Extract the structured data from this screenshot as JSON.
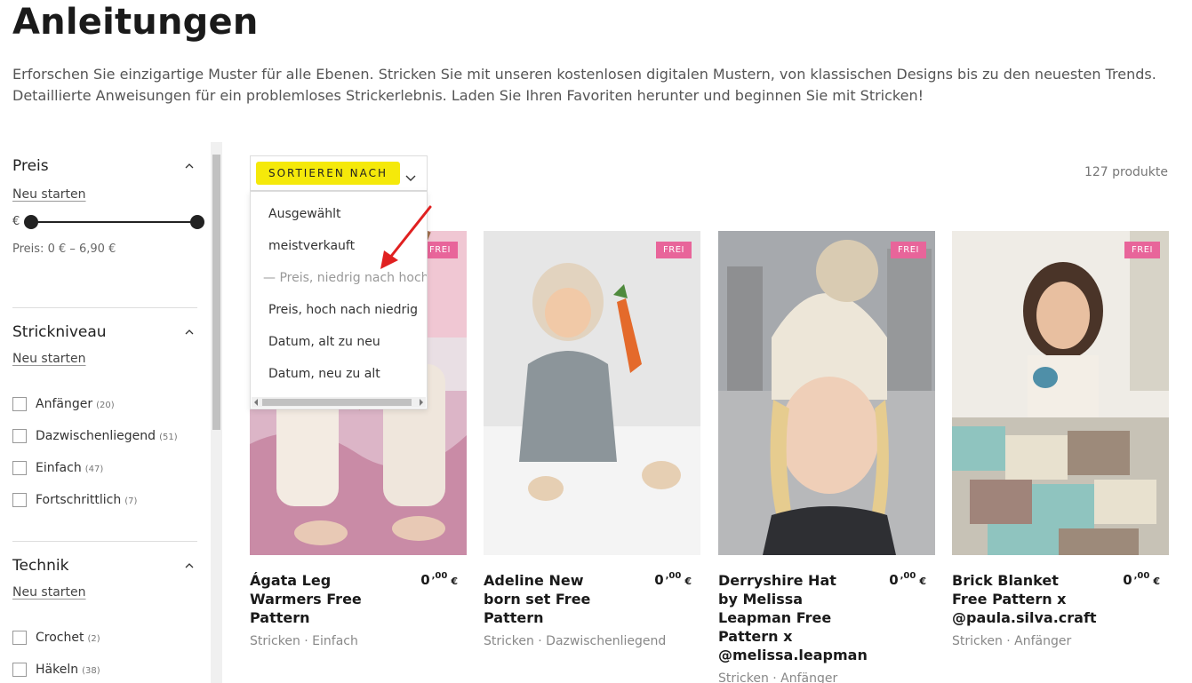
{
  "page": {
    "title": "Anleitungen",
    "intro": "Erforschen Sie einzigartige Muster für alle Ebenen. Stricken Sie mit unseren kostenlosen digitalen Mustern, von klassischen Designs bis zu den neuesten Trends. Detaillierte Anweisungen für ein problemloses Strickerlebnis. Laden Sie Ihren Favoriten herunter und beginnen Sie mit Stricken!"
  },
  "filters": {
    "price": {
      "title": "Preis",
      "reset": "Neu starten",
      "currency_label": "€",
      "range_text": "Preis: 0 € – 6,90 €"
    },
    "level": {
      "title": "Strickniveau",
      "reset": "Neu starten",
      "options": [
        {
          "label": "Anfänger",
          "count": "(20)"
        },
        {
          "label": "Dazwischenliegend",
          "count": "(51)"
        },
        {
          "label": "Einfach",
          "count": "(47)"
        },
        {
          "label": "Fortschrittlich",
          "count": "(7)"
        }
      ]
    },
    "technique": {
      "title": "Technik",
      "reset": "Neu starten",
      "options": [
        {
          "label": "Crochet",
          "count": "(2)"
        },
        {
          "label": "Häkeln",
          "count": "(38)"
        }
      ]
    }
  },
  "sort": {
    "label": "SORTIEREN NACH",
    "highlight_color": "#f5e90a",
    "options": [
      "Ausgewählt",
      "meistverkauft",
      "— Preis, niedrig nach hoch",
      "Preis, hoch nach niedrig",
      "Datum, alt zu neu",
      "Datum, neu zu alt"
    ]
  },
  "product_count": "127 produkte",
  "products": [
    {
      "badge": "FREI",
      "name": "Ágata Leg Warmers Free Pattern",
      "price_main": "0",
      "price_cents": ",00",
      "currency": "€",
      "meta": "Stricken · Einfach"
    },
    {
      "badge": "FREI",
      "name": "Adeline New born set Free Pattern",
      "price_main": "0",
      "price_cents": ",00",
      "currency": "€",
      "meta": "Stricken · Dazwischenliegend"
    },
    {
      "badge": "FREI",
      "name": "Derryshire Hat by Melissa Leapman Free Pattern x @melissa.leapman",
      "price_main": "0",
      "price_cents": ",00",
      "currency": "€",
      "meta": "Stricken · Anfänger"
    },
    {
      "badge": "FREI",
      "name": "Brick Blanket Free Pattern x @paula.silva.craft",
      "price_main": "0",
      "price_cents": ",00",
      "currency": "€",
      "meta": "Stricken · Anfänger"
    }
  ],
  "colors": {
    "badge": "#e8659a",
    "annotation_arrow": "#e02020"
  }
}
